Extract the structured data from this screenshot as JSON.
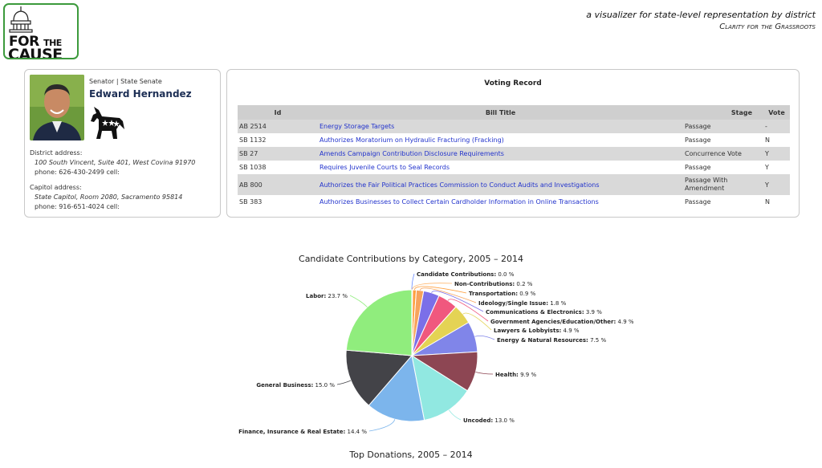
{
  "header": {
    "logo_line1": "FOR",
    "logo_line1_small": "THE",
    "logo_line2": "CAUSE",
    "tagline": "a visualizer for state-level representation by district",
    "subtagline": "Clarity for the Grassroots"
  },
  "profile": {
    "role": "Senator | State Senate",
    "name": "Edward Hernandez",
    "party_icon": "democrat-donkey-icon",
    "district_label": "District address:",
    "district_address": "100 South Vincent, Suite 401, West Covina 91970",
    "district_phone": "phone: 626-430-2499 cell:",
    "capitol_label": "Capitol address:",
    "capitol_address": "State Capitol, Room 2080, Sacramento 95814",
    "capitol_phone": "phone: 916-651-4024 cell:"
  },
  "voting": {
    "title": "Voting Record",
    "columns": [
      "Id",
      "Bill Title",
      "Stage",
      "Vote"
    ],
    "rows": [
      {
        "id": "AB 2514",
        "title": "Energy Storage Targets",
        "stage": "Passage",
        "vote": "-"
      },
      {
        "id": "SB 1132",
        "title": "Authorizes Moratorium on Hydraulic Fracturing (Fracking)",
        "stage": "Passage",
        "vote": "N"
      },
      {
        "id": "SB 27",
        "title": "Amends Campaign Contribution Disclosure Requirements",
        "stage": "Concurrence Vote",
        "vote": "Y"
      },
      {
        "id": "SB 1038",
        "title": "Requires Juvenile Courts to Seal Records",
        "stage": "Passage",
        "vote": "Y"
      },
      {
        "id": "AB 800",
        "title": "Authorizes the Fair Political Practices Commission to Conduct Audits and Investigations",
        "stage": "Passage With Amendment",
        "vote": "Y"
      },
      {
        "id": "SB 383",
        "title": "Authorizes Businesses to Collect Certain Cardholder Information in Online Transactions",
        "stage": "Passage",
        "vote": "N"
      }
    ]
  },
  "chart_data": {
    "type": "pie",
    "title": "Candidate Contributions by Category, 2005 – 2014",
    "unit": "%",
    "slices": [
      {
        "label": "Candidate Contributions",
        "value": 0.0,
        "color": "#6b8cff"
      },
      {
        "label": "Non-Contributions",
        "value": 0.2,
        "color": "#ffb870"
      },
      {
        "label": "Transportation",
        "value": 0.9,
        "color": "#ffa040"
      },
      {
        "label": "Ideology/Single Issue",
        "value": 1.8,
        "color": "#f7a35c"
      },
      {
        "label": "Communications & Electronics",
        "value": 3.9,
        "color": "#7b6fe8"
      },
      {
        "label": "Government Agencies/Education/Other",
        "value": 4.9,
        "color": "#f0587e"
      },
      {
        "label": "Lawyers & Lobbyists",
        "value": 4.9,
        "color": "#e4d354"
      },
      {
        "label": "Energy & Natural Resources",
        "value": 7.5,
        "color": "#8085e9"
      },
      {
        "label": "Health",
        "value": 9.9,
        "color": "#8d4653"
      },
      {
        "label": "Uncoded",
        "value": 13.0,
        "color": "#91e8e1"
      },
      {
        "label": "Finance, Insurance & Real Estate",
        "value": 14.4,
        "color": "#7cb5ec"
      },
      {
        "label": "General Business",
        "value": 15.0,
        "color": "#434348"
      },
      {
        "label": "Labor",
        "value": 23.7,
        "color": "#90ed7d"
      }
    ]
  },
  "donations": {
    "title": "Top Donations, 2005 – 2014"
  }
}
